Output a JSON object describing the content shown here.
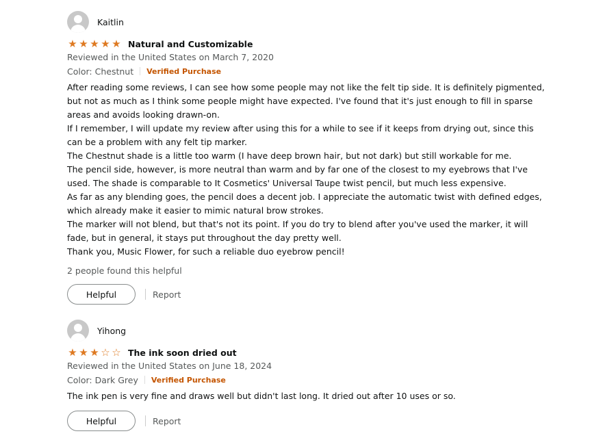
{
  "reviews": [
    {
      "profile_name": "Kaitlin",
      "rating": 5,
      "title": "Natural and Customizable",
      "date_line": "Reviewed in the United States on March 7, 2020",
      "variant": "Color: Chestnut",
      "verified": "Verified Purchase",
      "body": [
        "After reading some reviews, I can see how some people may not like the felt tip side. It is definitely pigmented, but not as much as I think some people might have expected. I've found that it's just enough to fill in sparse areas and avoids looking drawn-on.",
        "If I remember, I will update my review after using this for a while to see if it keeps from drying out, since this can be a problem with any felt tip marker.",
        "The Chestnut shade is a little too warm (I have deep brown hair, but not dark) but still workable for me.",
        "The pencil side, however, is more neutral than warm and by far one of the closest to my eyebrows that I've used. The shade is comparable to It Cosmetics' Universal Taupe twist pencil, but much less expensive.",
        "As far as any blending goes, the pencil does a decent job. I appreciate the automatic twist with defined edges, which already make it easier to mimic natural brow strokes.",
        "The marker will not blend, but that's not its point. If you do try to blend after you've used the marker, it will fade, but in general, it stays put throughout the day pretty well.",
        "Thank you, Music Flower, for such a reliable duo eyebrow pencil!"
      ],
      "helpful_count": "2 people found this helpful",
      "helpful_label": "Helpful",
      "report_label": "Report"
    },
    {
      "profile_name": "Yihong",
      "rating": 3,
      "title": "The ink soon dried out",
      "date_line": "Reviewed in the United States on June 18, 2024",
      "variant": "Color: Dark Grey",
      "verified": "Verified Purchase",
      "body": [
        "The ink pen is very fine and draws well but didn't last long. It dried out after 10 uses or so."
      ],
      "helpful_label": "Helpful",
      "report_label": "Report"
    }
  ],
  "colors": {
    "star": "#de7921",
    "verified": "#c45500",
    "meta": "#565959"
  }
}
